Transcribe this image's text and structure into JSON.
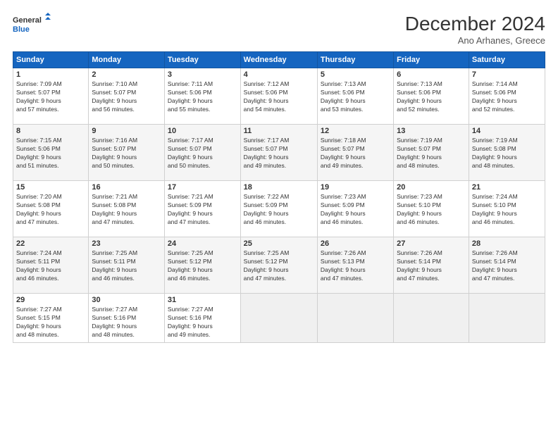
{
  "logo": {
    "line1": "General",
    "line2": "Blue"
  },
  "title": "December 2024",
  "subtitle": "Ano Arhanes, Greece",
  "weekdays": [
    "Sunday",
    "Monday",
    "Tuesday",
    "Wednesday",
    "Thursday",
    "Friday",
    "Saturday"
  ],
  "weeks": [
    [
      {
        "day": "1",
        "info": "Sunrise: 7:09 AM\nSunset: 5:07 PM\nDaylight: 9 hours\nand 57 minutes."
      },
      {
        "day": "2",
        "info": "Sunrise: 7:10 AM\nSunset: 5:07 PM\nDaylight: 9 hours\nand 56 minutes."
      },
      {
        "day": "3",
        "info": "Sunrise: 7:11 AM\nSunset: 5:06 PM\nDaylight: 9 hours\nand 55 minutes."
      },
      {
        "day": "4",
        "info": "Sunrise: 7:12 AM\nSunset: 5:06 PM\nDaylight: 9 hours\nand 54 minutes."
      },
      {
        "day": "5",
        "info": "Sunrise: 7:13 AM\nSunset: 5:06 PM\nDaylight: 9 hours\nand 53 minutes."
      },
      {
        "day": "6",
        "info": "Sunrise: 7:13 AM\nSunset: 5:06 PM\nDaylight: 9 hours\nand 52 minutes."
      },
      {
        "day": "7",
        "info": "Sunrise: 7:14 AM\nSunset: 5:06 PM\nDaylight: 9 hours\nand 52 minutes."
      }
    ],
    [
      {
        "day": "8",
        "info": "Sunrise: 7:15 AM\nSunset: 5:06 PM\nDaylight: 9 hours\nand 51 minutes."
      },
      {
        "day": "9",
        "info": "Sunrise: 7:16 AM\nSunset: 5:07 PM\nDaylight: 9 hours\nand 50 minutes."
      },
      {
        "day": "10",
        "info": "Sunrise: 7:17 AM\nSunset: 5:07 PM\nDaylight: 9 hours\nand 50 minutes."
      },
      {
        "day": "11",
        "info": "Sunrise: 7:17 AM\nSunset: 5:07 PM\nDaylight: 9 hours\nand 49 minutes."
      },
      {
        "day": "12",
        "info": "Sunrise: 7:18 AM\nSunset: 5:07 PM\nDaylight: 9 hours\nand 49 minutes."
      },
      {
        "day": "13",
        "info": "Sunrise: 7:19 AM\nSunset: 5:07 PM\nDaylight: 9 hours\nand 48 minutes."
      },
      {
        "day": "14",
        "info": "Sunrise: 7:19 AM\nSunset: 5:08 PM\nDaylight: 9 hours\nand 48 minutes."
      }
    ],
    [
      {
        "day": "15",
        "info": "Sunrise: 7:20 AM\nSunset: 5:08 PM\nDaylight: 9 hours\nand 47 minutes."
      },
      {
        "day": "16",
        "info": "Sunrise: 7:21 AM\nSunset: 5:08 PM\nDaylight: 9 hours\nand 47 minutes."
      },
      {
        "day": "17",
        "info": "Sunrise: 7:21 AM\nSunset: 5:09 PM\nDaylight: 9 hours\nand 47 minutes."
      },
      {
        "day": "18",
        "info": "Sunrise: 7:22 AM\nSunset: 5:09 PM\nDaylight: 9 hours\nand 46 minutes."
      },
      {
        "day": "19",
        "info": "Sunrise: 7:23 AM\nSunset: 5:09 PM\nDaylight: 9 hours\nand 46 minutes."
      },
      {
        "day": "20",
        "info": "Sunrise: 7:23 AM\nSunset: 5:10 PM\nDaylight: 9 hours\nand 46 minutes."
      },
      {
        "day": "21",
        "info": "Sunrise: 7:24 AM\nSunset: 5:10 PM\nDaylight: 9 hours\nand 46 minutes."
      }
    ],
    [
      {
        "day": "22",
        "info": "Sunrise: 7:24 AM\nSunset: 5:11 PM\nDaylight: 9 hours\nand 46 minutes."
      },
      {
        "day": "23",
        "info": "Sunrise: 7:25 AM\nSunset: 5:11 PM\nDaylight: 9 hours\nand 46 minutes."
      },
      {
        "day": "24",
        "info": "Sunrise: 7:25 AM\nSunset: 5:12 PM\nDaylight: 9 hours\nand 46 minutes."
      },
      {
        "day": "25",
        "info": "Sunrise: 7:25 AM\nSunset: 5:12 PM\nDaylight: 9 hours\nand 47 minutes."
      },
      {
        "day": "26",
        "info": "Sunrise: 7:26 AM\nSunset: 5:13 PM\nDaylight: 9 hours\nand 47 minutes."
      },
      {
        "day": "27",
        "info": "Sunrise: 7:26 AM\nSunset: 5:14 PM\nDaylight: 9 hours\nand 47 minutes."
      },
      {
        "day": "28",
        "info": "Sunrise: 7:26 AM\nSunset: 5:14 PM\nDaylight: 9 hours\nand 47 minutes."
      }
    ],
    [
      {
        "day": "29",
        "info": "Sunrise: 7:27 AM\nSunset: 5:15 PM\nDaylight: 9 hours\nand 48 minutes."
      },
      {
        "day": "30",
        "info": "Sunrise: 7:27 AM\nSunset: 5:16 PM\nDaylight: 9 hours\nand 48 minutes."
      },
      {
        "day": "31",
        "info": "Sunrise: 7:27 AM\nSunset: 5:16 PM\nDaylight: 9 hours\nand 49 minutes."
      },
      null,
      null,
      null,
      null
    ]
  ]
}
